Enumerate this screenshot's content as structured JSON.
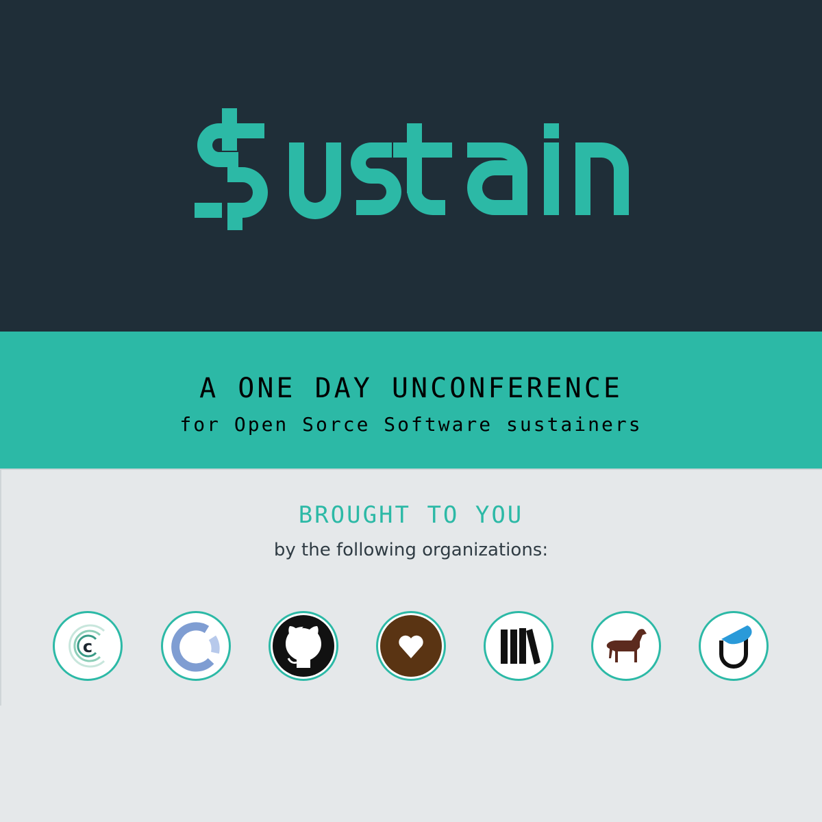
{
  "brand": {
    "name": "$ustain",
    "accent": "#2cb9a6",
    "hero_bg": "#1f2e38"
  },
  "band": {
    "title": "A ONE DAY UNCONFERENCE",
    "subtitle": "for Open Sorce Software sustainers",
    "bg": "#2cb9a6"
  },
  "sponsors": {
    "heading": "BROUGHT TO YOU",
    "byline": "by the following organizations:",
    "logos": [
      "c-ring-icon",
      "open-ring-icon",
      "github-octocat-icon",
      "heart-icon",
      "books-icon",
      "horse-icon",
      "u-drop-icon"
    ]
  }
}
